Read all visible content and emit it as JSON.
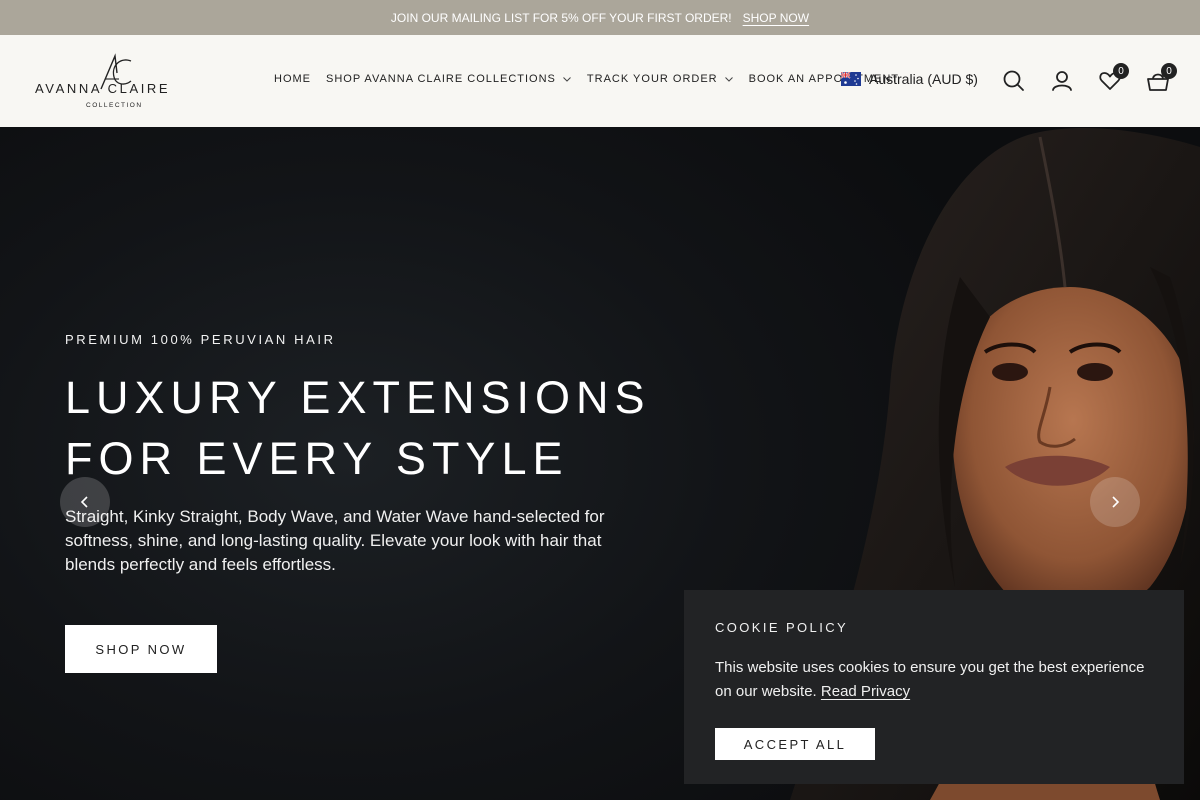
{
  "announcement": {
    "message": "JOIN OUR MAILING LIST FOR 5% OFF YOUR FIRST ORDER!",
    "link": "SHOP NOW"
  },
  "header": {
    "logo": {
      "monogram": "AC",
      "brand": "AVANNA CLAIRE",
      "sub": "COLLECTION"
    },
    "nav": [
      {
        "label": "HOME"
      },
      {
        "label": "SHOP AVANNA CLAIRE COLLECTIONS"
      },
      {
        "label": "TRACK YOUR ORDER"
      },
      {
        "label": "BOOK AN APPOINTMENT"
      }
    ],
    "country": "Australia (AUD $)",
    "wishlist_count": "0",
    "cart_count": "0"
  },
  "hero": {
    "kicker": "PREMIUM 100% PERUVIAN HAIR",
    "title": "LUXURY EXTENSIONS FOR EVERY STYLE",
    "description": "Straight, Kinky Straight, Body Wave, and Water Wave hand-selected for softness, shine, and long-lasting quality. Elevate your look with hair that blends perfectly and feels effortless.",
    "cta": "SHOP NOW"
  },
  "cookie": {
    "title": "COOKIE POLICY",
    "text": "This website uses cookies to ensure you get the best experience on our website.",
    "link": "Read Privacy",
    "accept": "ACCEPT ALL"
  },
  "icons": {
    "search": "search-icon",
    "account": "user-icon",
    "wishlist": "heart-icon",
    "cart": "basket-icon",
    "prev": "chevron-left-icon",
    "next": "chevron-right-icon",
    "dropdown": "chevron-down-icon"
  },
  "colors": {
    "announcement_bg": "#aba69a",
    "header_bg": "#f8f7f3",
    "hero_bg": "#121417",
    "cookie_bg": "#222325",
    "button_bg": "#ffffff",
    "text_dark": "#222222"
  }
}
